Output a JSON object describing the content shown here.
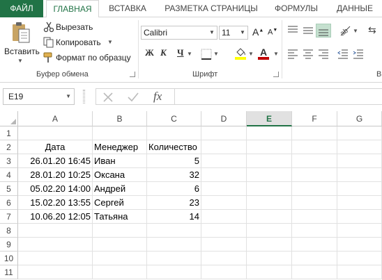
{
  "ribbon_tabs": {
    "file": "ФАЙЛ",
    "home": "ГЛАВНАЯ",
    "insert": "ВСТАВКА",
    "page_layout": "РАЗМЕТКА СТРАНИЦЫ",
    "formulas": "ФОРМУЛЫ",
    "data": "ДАННЫЕ"
  },
  "clipboard": {
    "paste": "Вставить",
    "cut": "Вырезать",
    "copy": "Копировать",
    "format_painter": "Формат по образцу",
    "label": "Буфер обмена"
  },
  "font": {
    "name": "Calibri",
    "size": "11",
    "bold": "Ж",
    "italic": "К",
    "underline": "Ч",
    "label": "Шрифт"
  },
  "colors": {
    "accent": "#217346",
    "fill_swatch": "#ffff00",
    "font_swatch": "#c00000"
  },
  "formula_bar": {
    "name_box": "E19",
    "fx": "fx",
    "value": ""
  },
  "grid": {
    "columns": [
      "A",
      "B",
      "C",
      "D",
      "E",
      "F",
      "G"
    ],
    "selected_column": "E",
    "rows": [
      "1",
      "2",
      "3",
      "4",
      "5",
      "6",
      "7",
      "8",
      "9",
      "10",
      "11"
    ],
    "headers": {
      "date": "Дата",
      "manager": "Менеджер",
      "quantity": "Количество"
    },
    "data": [
      {
        "date": "26.01.20 16:45",
        "manager": "Иван",
        "quantity": "5"
      },
      {
        "date": "28.01.20 10:25",
        "manager": "Оксана",
        "quantity": "32"
      },
      {
        "date": "05.02.20 14:00",
        "manager": "Андрей",
        "quantity": "6"
      },
      {
        "date": "15.02.20 13:55",
        "manager": "Сергей",
        "quantity": "23"
      },
      {
        "date": "10.06.20 12:05",
        "manager": "Татьяна",
        "quantity": "14"
      }
    ]
  }
}
